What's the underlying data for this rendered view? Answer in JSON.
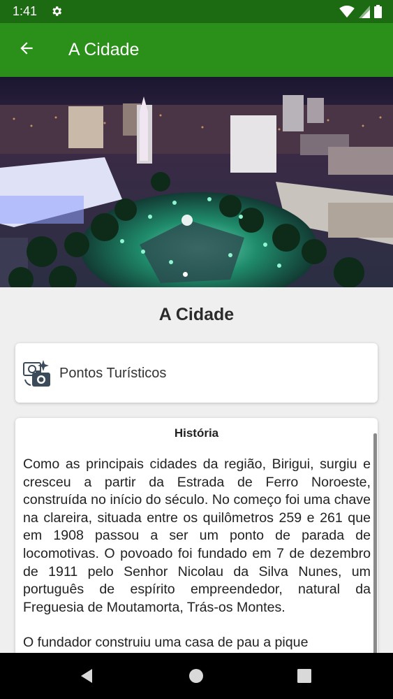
{
  "status_bar": {
    "time": "1:41",
    "icons": [
      "gear-icon",
      "wifi-icon",
      "signal-icon",
      "battery-icon"
    ]
  },
  "app_bar": {
    "title": "A Cidade",
    "back_icon": "arrow-back-icon"
  },
  "carousel": {
    "image_description_icon": "city-night-photo",
    "pages": 1,
    "active_page": 1
  },
  "section_title": "A Cidade",
  "points_of_interest": {
    "label": "Pontos Turísticos",
    "icon": "tourist-photo-icon"
  },
  "history": {
    "title": "História",
    "paragraphs": [
      "Como as principais cidades da região, Birigui, surgiu e cresceu a partir da Estrada de Ferro Noroeste, construída no início do século. No começo foi uma chave na clareira, situada entre os quilômetros 259 e 261 que em 1908 passou a ser um ponto de parada de locomotivas. O povoado foi fundado em 7 de dezembro de 1911 pelo Senhor Nicolau da Silva Nunes, um português de espírito empreendedor, natural da Freguesia de Moutamorta, Trás-os Montes.",
      "O fundador construiu uma casa de pau a pique"
    ]
  },
  "nav_bar": {
    "buttons": [
      "back-triangle-icon",
      "home-circle-icon",
      "recents-square-icon"
    ]
  },
  "colors": {
    "status_bar": "#1c6b12",
    "app_bar": "#2a9019",
    "background": "#efefef"
  }
}
